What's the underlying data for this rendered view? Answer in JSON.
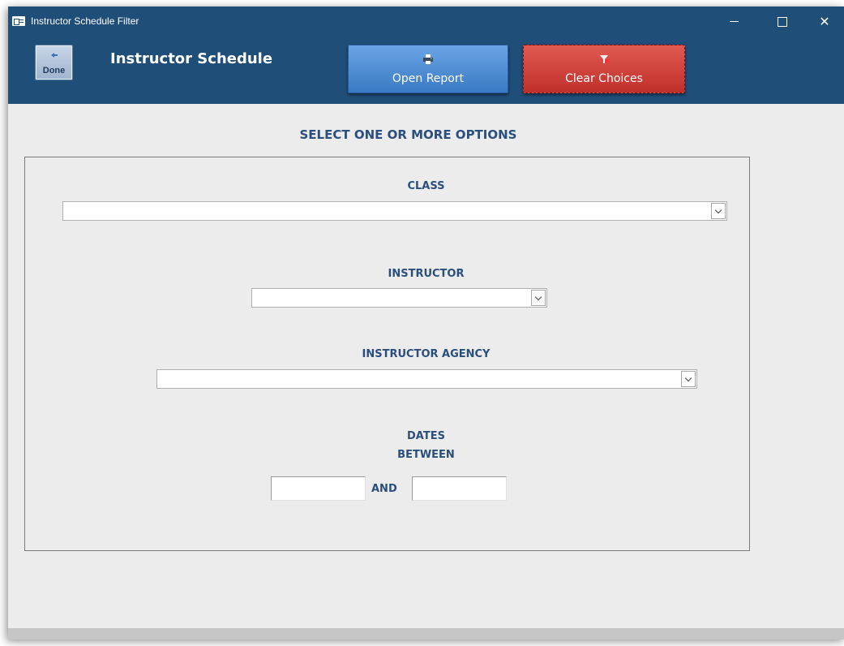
{
  "window": {
    "title": "Instructor Schedule Filter"
  },
  "header": {
    "done_label": "Done",
    "title": "Instructor Schedule",
    "open_report_label": "Open Report",
    "clear_choices_label": "Clear Choices"
  },
  "form": {
    "section_title": "SELECT ONE OR MORE OPTIONS",
    "class_label": "CLASS",
    "class_value": "",
    "instructor_label": "INSTRUCTOR",
    "instructor_value": "",
    "agency_label": "INSTRUCTOR AGENCY",
    "agency_value": "",
    "dates_label_line1": "DATES",
    "dates_label_line2": "BETWEEN",
    "start_date_value": "",
    "and_label": "AND",
    "end_date_value": ""
  },
  "colors": {
    "header_bg": "#1f4e79",
    "open_button": "#3a79c5",
    "clear_button": "#c0302a",
    "label_text": "#2a4e7e",
    "form_bg": "#ececec"
  },
  "icons": {
    "app": "form-icon",
    "done": "back-arrow-icon",
    "open_report": "printer-icon",
    "clear_choices": "filter-clear-icon"
  }
}
